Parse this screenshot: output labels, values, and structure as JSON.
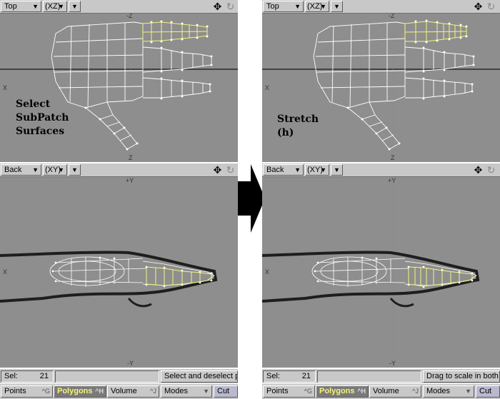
{
  "before": {
    "top": {
      "view": "Top",
      "projection": "(XZ)",
      "axis_up": "-Z",
      "axis_down": "Z",
      "axis_left": "X"
    },
    "back": {
      "view": "Back",
      "projection": "(XY)",
      "axis_up": "+Y",
      "axis_down": "-Y",
      "axis_left": "X"
    },
    "caption": [
      "Select",
      "SubPatch",
      "Surfaces"
    ],
    "status": {
      "sel_label": "Sel:",
      "sel_count": "21",
      "hint": "Select and deselect p"
    },
    "modes": {
      "points": "Points",
      "points_key": "^G",
      "polygons": "Polygons",
      "polygons_key": "^H",
      "volume": "Volume",
      "volume_key": "^J",
      "modes": "Modes",
      "cut": "Cut"
    }
  },
  "after": {
    "top": {
      "view": "Top",
      "projection": "(XZ)",
      "axis_up": "-Z",
      "axis_down": "Z",
      "axis_left": "X"
    },
    "back": {
      "view": "Back",
      "projection": "(XY)",
      "axis_up": "+Y",
      "axis_down": "-Y",
      "axis_left": "X"
    },
    "caption": [
      "Stretch",
      "(h)"
    ],
    "status": {
      "sel_label": "Sel:",
      "sel_count": "21",
      "hint": "Drag to scale in both a"
    },
    "modes": {
      "points": "Points",
      "points_key": "^G",
      "polygons": "Polygons",
      "polygons_key": "^H",
      "volume": "Volume",
      "volume_key": "^J",
      "modes": "Modes",
      "cut": "Cut"
    }
  },
  "icons": {
    "move": "move-view-icon",
    "rotate": "rotate-view-icon",
    "dropdown": "dropdown-arrow-icon",
    "transition": "right-arrow-icon"
  },
  "colors": {
    "viewport_bg": "#8e8e8e",
    "wire": "#ffffff",
    "selected_wire": "#f4f47a",
    "toolbar": "#c8c8c8",
    "active_mode": "#7a7a7a"
  }
}
